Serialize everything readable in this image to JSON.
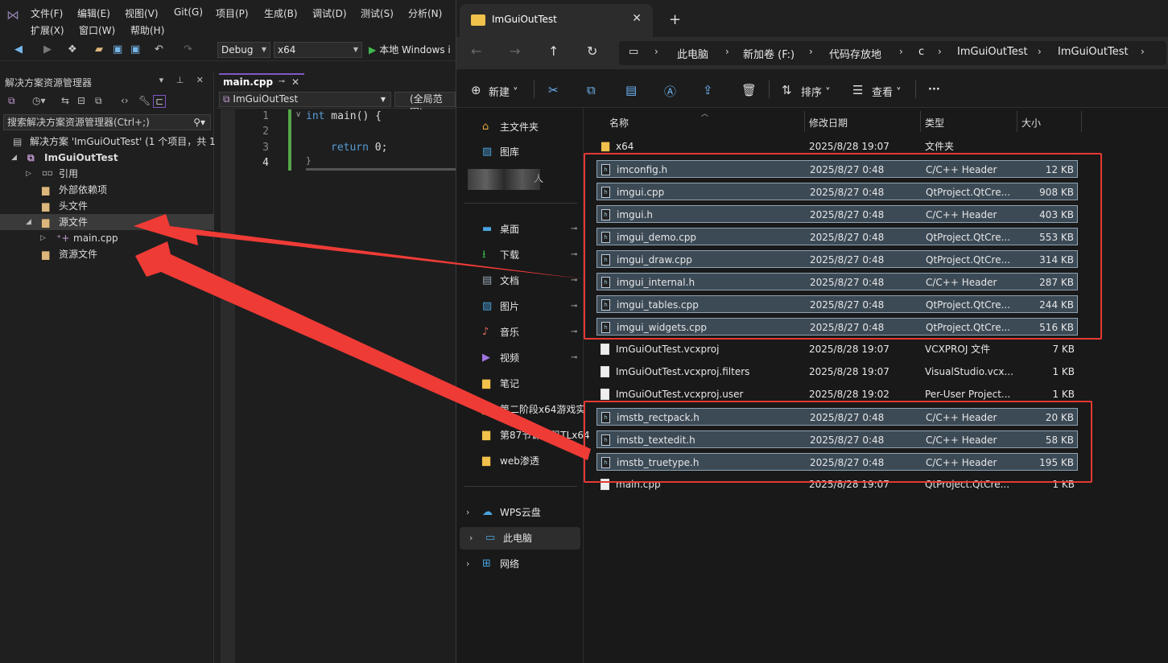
{
  "vs": {
    "menu": [
      "文件(F)",
      "编辑(E)",
      "视图(V)",
      "Git(G)",
      "项目(P)",
      "生成(B)",
      "调试(D)",
      "测试(S)",
      "分析(N)"
    ],
    "menu2": [
      "扩展(X)",
      "窗口(W)",
      "帮助(H)"
    ],
    "config": "Debug",
    "platform": "x64",
    "run_label": "本地 Windows i",
    "solution_explorer": {
      "title": "解决方案资源管理器",
      "search_placeholder": "搜索解决方案资源管理器(Ctrl+;)",
      "tree": [
        {
          "label": "解决方案 'ImGuiOutTest' (1 个项目，共 1",
          "indent": 0
        },
        {
          "label": "ImGuiOutTest",
          "indent": 1,
          "bold": true
        },
        {
          "label": "引用",
          "indent": 2
        },
        {
          "label": "外部依赖项",
          "indent": 2
        },
        {
          "label": "头文件",
          "indent": 2
        },
        {
          "label": "源文件",
          "indent": 2,
          "selected": true
        },
        {
          "label": "main.cpp",
          "indent": 3
        },
        {
          "label": "资源文件",
          "indent": 2
        }
      ]
    },
    "editor": {
      "tab": "main.cpp",
      "nav_project": "ImGuiOutTest",
      "nav_scope": "(全局范围)",
      "lines": [
        "1",
        "2",
        "3",
        "4"
      ],
      "code": {
        "l1_kw": "int",
        "l1_rest": " main() {",
        "l3_kw": "return",
        "l3_rest": " 0;",
        "l4": "}"
      }
    }
  },
  "explorer": {
    "tab_title": "ImGuiOutTest",
    "breadcrumbs": [
      "此电脑",
      "新加卷 (F:)",
      "代码存放地",
      "c",
      "ImGuiOutTest",
      "ImGuiOutTest"
    ],
    "commands": {
      "new": "新建",
      "sort": "排序",
      "view": "查看"
    },
    "sidebar": [
      {
        "label": "主文件夹",
        "icon": "home-icon"
      },
      {
        "label": "图库",
        "icon": "gallery-icon"
      },
      {
        "label": "人",
        "icon": "person-icon"
      },
      {
        "label": "桌面",
        "icon": "desktop-icon",
        "pinned": true
      },
      {
        "label": "下载",
        "icon": "download-icon",
        "pinned": true
      },
      {
        "label": "文档",
        "icon": "document-icon",
        "pinned": true
      },
      {
        "label": "图片",
        "icon": "picture-icon",
        "pinned": true
      },
      {
        "label": "音乐",
        "icon": "music-icon",
        "pinned": true
      },
      {
        "label": "视频",
        "icon": "video-icon",
        "pinned": true
      },
      {
        "label": "笔记",
        "icon": "folder-icon"
      },
      {
        "label": "第二阶段x64游戏实",
        "icon": "folder-icon"
      },
      {
        "label": "第87节课代码TLx64",
        "icon": "folder-icon"
      },
      {
        "label": "web渗透",
        "icon": "folder-icon"
      },
      {
        "label": "WPS云盘",
        "icon": "cloud-icon"
      },
      {
        "label": "此电脑",
        "icon": "computer-icon",
        "selected": true
      },
      {
        "label": "网络",
        "icon": "network-icon"
      }
    ],
    "columns": {
      "name": "名称",
      "date": "修改日期",
      "type": "类型",
      "size": "大小"
    },
    "files": [
      {
        "name": "x64",
        "date": "2025/8/28 19:07",
        "type": "文件夹",
        "size": "",
        "kind": "folder",
        "selected": false
      },
      {
        "name": "imconfig.h",
        "date": "2025/8/27 0:48",
        "type": "C/C++ Header",
        "size": "12 KB",
        "kind": "header",
        "selected": true
      },
      {
        "name": "imgui.cpp",
        "date": "2025/8/27 0:48",
        "type": "QtProject.QtCre...",
        "size": "908 KB",
        "kind": "header",
        "selected": true
      },
      {
        "name": "imgui.h",
        "date": "2025/8/27 0:48",
        "type": "C/C++ Header",
        "size": "403 KB",
        "kind": "header",
        "selected": true
      },
      {
        "name": "imgui_demo.cpp",
        "date": "2025/8/27 0:48",
        "type": "QtProject.QtCre...",
        "size": "553 KB",
        "kind": "header",
        "selected": true
      },
      {
        "name": "imgui_draw.cpp",
        "date": "2025/8/27 0:48",
        "type": "QtProject.QtCre...",
        "size": "314 KB",
        "kind": "header",
        "selected": true
      },
      {
        "name": "imgui_internal.h",
        "date": "2025/8/27 0:48",
        "type": "C/C++ Header",
        "size": "287 KB",
        "kind": "header",
        "selected": true
      },
      {
        "name": "imgui_tables.cpp",
        "date": "2025/8/27 0:48",
        "type": "QtProject.QtCre...",
        "size": "244 KB",
        "kind": "header",
        "selected": true
      },
      {
        "name": "imgui_widgets.cpp",
        "date": "2025/8/27 0:48",
        "type": "QtProject.QtCre...",
        "size": "516 KB",
        "kind": "header",
        "selected": true
      },
      {
        "name": "ImGuiOutTest.vcxproj",
        "date": "2025/8/28 19:07",
        "type": "VCXPROJ 文件",
        "size": "7 KB",
        "kind": "file",
        "selected": false
      },
      {
        "name": "ImGuiOutTest.vcxproj.filters",
        "date": "2025/8/28 19:07",
        "type": "VisualStudio.vcx...",
        "size": "1 KB",
        "kind": "file",
        "selected": false
      },
      {
        "name": "ImGuiOutTest.vcxproj.user",
        "date": "2025/8/28 19:02",
        "type": "Per-User Project...",
        "size": "1 KB",
        "kind": "file",
        "selected": false
      },
      {
        "name": "imstb_rectpack.h",
        "date": "2025/8/27 0:48",
        "type": "C/C++ Header",
        "size": "20 KB",
        "kind": "header",
        "selected": true
      },
      {
        "name": "imstb_textedit.h",
        "date": "2025/8/27 0:48",
        "type": "C/C++ Header",
        "size": "58 KB",
        "kind": "header",
        "selected": true
      },
      {
        "name": "imstb_truetype.h",
        "date": "2025/8/27 0:48",
        "type": "C/C++ Header",
        "size": "195 KB",
        "kind": "header",
        "selected": true
      },
      {
        "name": "main.cpp",
        "date": "2025/8/28 19:07",
        "type": "QtProject.QtCre...",
        "size": "1 KB",
        "kind": "file",
        "selected": false
      }
    ]
  },
  "colors": {
    "annotation": "#e53935",
    "accent": "#7e57c2",
    "selection": "#3c4a56"
  }
}
